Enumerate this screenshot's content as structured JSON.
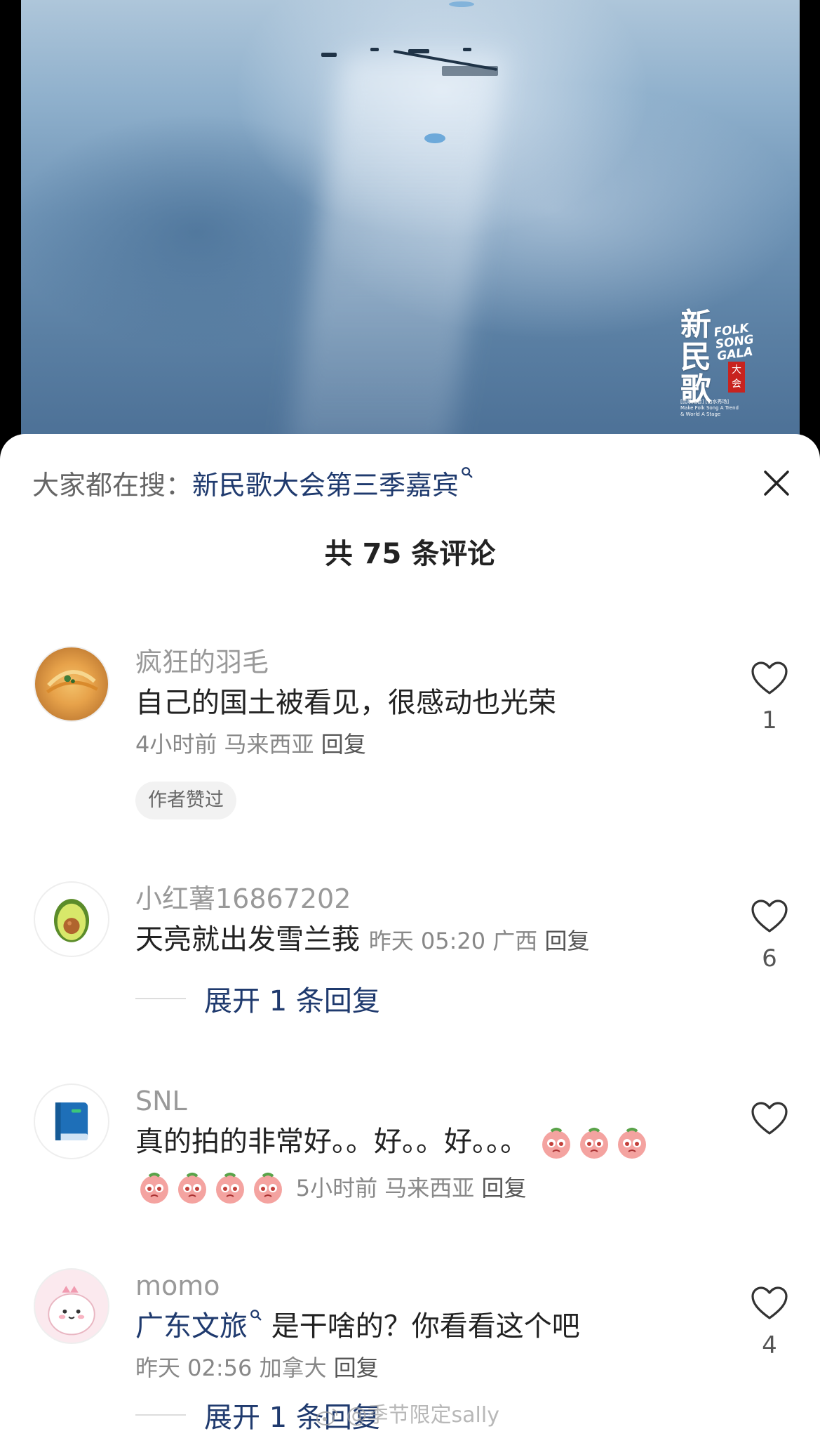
{
  "logo": {
    "big": "新民歌",
    "english": "FOLK SONG GALA",
    "seal": "大会",
    "slogan_cn": "[民歌潮音] [山水秀场]",
    "slogan_en1": "Make Folk Song A Trend",
    "slogan_en2": "& World A Stage"
  },
  "search": {
    "prefix": "大家都在搜：",
    "query": "新民歌大会第三季嘉宾"
  },
  "header": {
    "count": "共 75 条评论"
  },
  "comments": [
    {
      "user": "疯狂的羽毛",
      "text": "自己的国土被看见，很感动也光荣",
      "time": "4小时前",
      "region": "马来西亚",
      "reply": "回复",
      "badge": "作者赞过",
      "likes": "1",
      "avatar": "food-bowl"
    },
    {
      "user": "小红薯16867202",
      "text": "天亮就出发雪兰莪",
      "time": "昨天 05:20",
      "region": "广西",
      "reply": "回复",
      "likes": "6",
      "expand": "展开 1 条回复",
      "avatar": "avocado"
    },
    {
      "user": "SNL",
      "text": "真的拍的非常好。。好。。好。。。",
      "time": "5小时前",
      "region": "马来西亚",
      "reply": "回复",
      "likes": "",
      "avatar": "book"
    },
    {
      "user": "momo",
      "topic": "广东文旅",
      "text": "是干啥的？你看看这个吧",
      "time": "昨天 02:56",
      "region": "加拿大",
      "reply": "回复",
      "likes": "4",
      "expand": "展开 1 条回复",
      "avatar": "pink-dino"
    }
  ],
  "watermark": "@季节限定sally",
  "colors": {
    "link": "#1f3a6e",
    "muted": "#999999",
    "text": "#222222"
  }
}
